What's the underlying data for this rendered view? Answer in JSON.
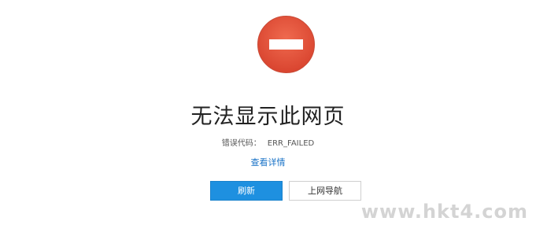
{
  "error": {
    "icon": "no-entry-icon",
    "title": "无法显示此网页",
    "code_label": "错误代码：",
    "code_value": "ERR_FAILED",
    "details_link": "查看详情"
  },
  "buttons": {
    "refresh_label": "刷新",
    "nav_label": "上网导航"
  },
  "watermark": "www.hkt4.com",
  "colors": {
    "icon_red": "#e2553e",
    "primary_blue": "#1e90e0",
    "link_blue": "#1a73c7"
  }
}
